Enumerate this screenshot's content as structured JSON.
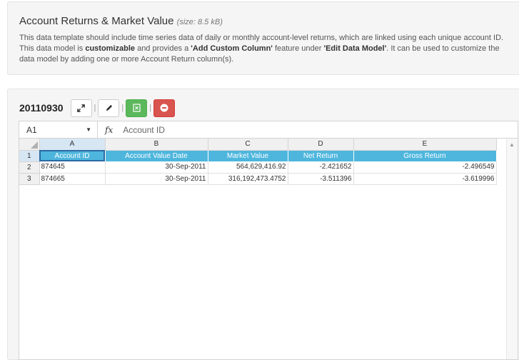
{
  "info": {
    "title": "Account Returns & Market Value",
    "size": "(size: 8.5 kB)",
    "desc_1": "This data template should include time series data of daily or monthly account-level returns, which are linked using each unique account ID. This data model is ",
    "desc_bold_1": "customizable",
    "desc_2": " and provides a ",
    "desc_bold_2": "'Add Custom Column'",
    "desc_3": " feature under ",
    "desc_bold_3": "'Edit Data Model'",
    "desc_4": ". It can be used to customize the data model by adding one or more Account Return column(s)."
  },
  "toolbar": {
    "date": "20110930",
    "expand_icon": "expand-icon",
    "edit_icon": "pencil-icon",
    "excel_icon": "excel-icon",
    "remove_icon": "minus-circle-icon"
  },
  "formula": {
    "cell_ref": "A1",
    "fx": "fx",
    "value": "Account ID"
  },
  "grid": {
    "columns": [
      "A",
      "B",
      "C",
      "D",
      "E"
    ],
    "row_numbers": [
      "1",
      "2",
      "3"
    ],
    "headers": [
      "Account ID",
      "Account Value Date",
      "Market Value",
      "Net Return",
      "Gross Return"
    ],
    "rows": [
      [
        "874645",
        "30-Sep-2011",
        "564,629,416.92",
        "-2.421652",
        "-2.496549"
      ],
      [
        "874665",
        "30-Sep-2011",
        "316,192,473.4752",
        "-3.511396",
        "-3.619996"
      ]
    ]
  },
  "colors": {
    "header_bg": "#4eb6dd",
    "excel_green": "#5cb85c",
    "remove_red": "#d9534f"
  }
}
